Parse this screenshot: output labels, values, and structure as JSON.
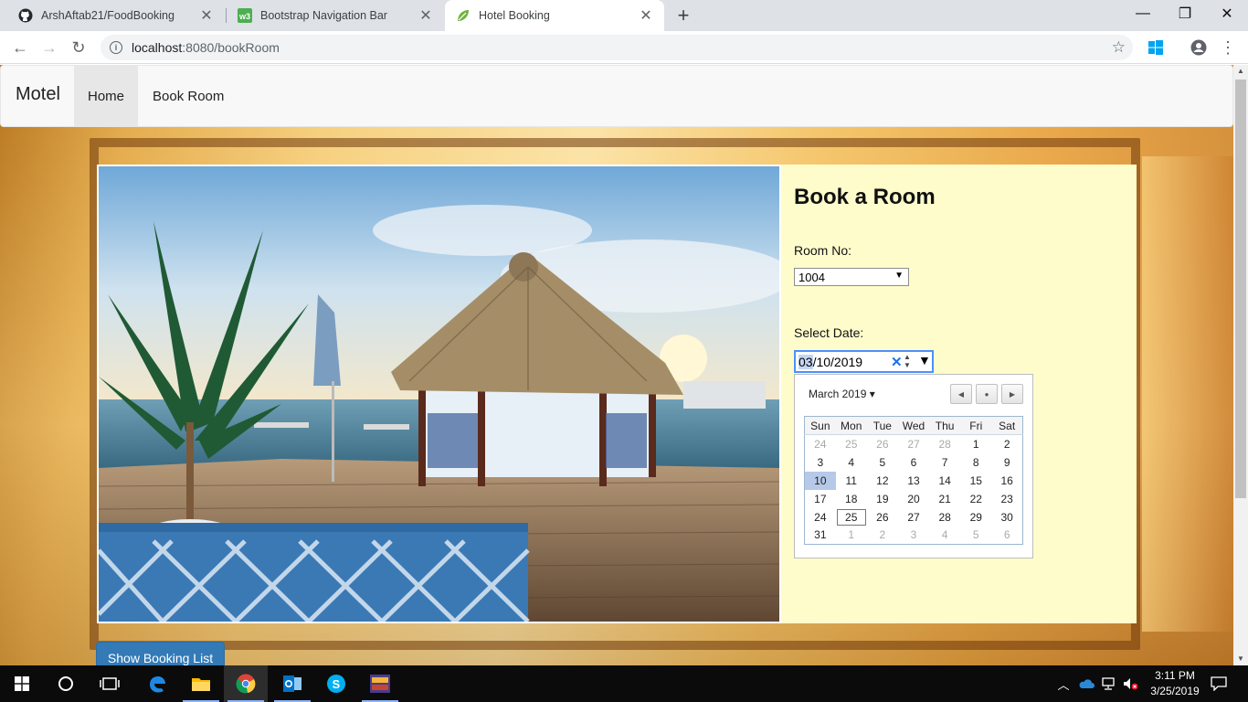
{
  "browser": {
    "tabs": [
      {
        "title": "ArshAftab21/FoodBooking",
        "icon": "github-icon"
      },
      {
        "title": "Bootstrap Navigation Bar",
        "icon": "w3schools-icon"
      },
      {
        "title": "Hotel Booking",
        "icon": "spring-leaf-icon"
      }
    ],
    "url_host": "localhost",
    "url_rest": ":8080/bookRoom"
  },
  "navbar": {
    "brand": "Motel",
    "items": [
      {
        "label": "Home",
        "active": true
      },
      {
        "label": "Book Room",
        "active": false
      }
    ]
  },
  "form": {
    "title": "Book a Room",
    "room_label": "Room No:",
    "room_value": "1004",
    "date_label": "Select Date:",
    "date_month_part": "03",
    "date_rest": "/10/2019"
  },
  "datepicker": {
    "month_label": "March 2019",
    "weekdays": [
      "Sun",
      "Mon",
      "Tue",
      "Wed",
      "Thu",
      "Fri",
      "Sat"
    ],
    "weeks": [
      [
        "24",
        "25",
        "26",
        "27",
        "28",
        "1",
        "2"
      ],
      [
        "3",
        "4",
        "5",
        "6",
        "7",
        "8",
        "9"
      ],
      [
        "10",
        "11",
        "12",
        "13",
        "14",
        "15",
        "16"
      ],
      [
        "17",
        "18",
        "19",
        "20",
        "21",
        "22",
        "23"
      ],
      [
        "24",
        "25",
        "26",
        "27",
        "28",
        "29",
        "30"
      ],
      [
        "31",
        "1",
        "2",
        "3",
        "4",
        "5",
        "6"
      ]
    ],
    "selected_day": "10",
    "today_day": "25"
  },
  "show_booking_button": "Show Booking List",
  "taskbar": {
    "time": "3:11 PM",
    "date": "3/25/2019"
  },
  "colors": {
    "form_bg": "#fffccc",
    "button_primary": "#337ab7",
    "selected_day": "#b7c9e8"
  }
}
